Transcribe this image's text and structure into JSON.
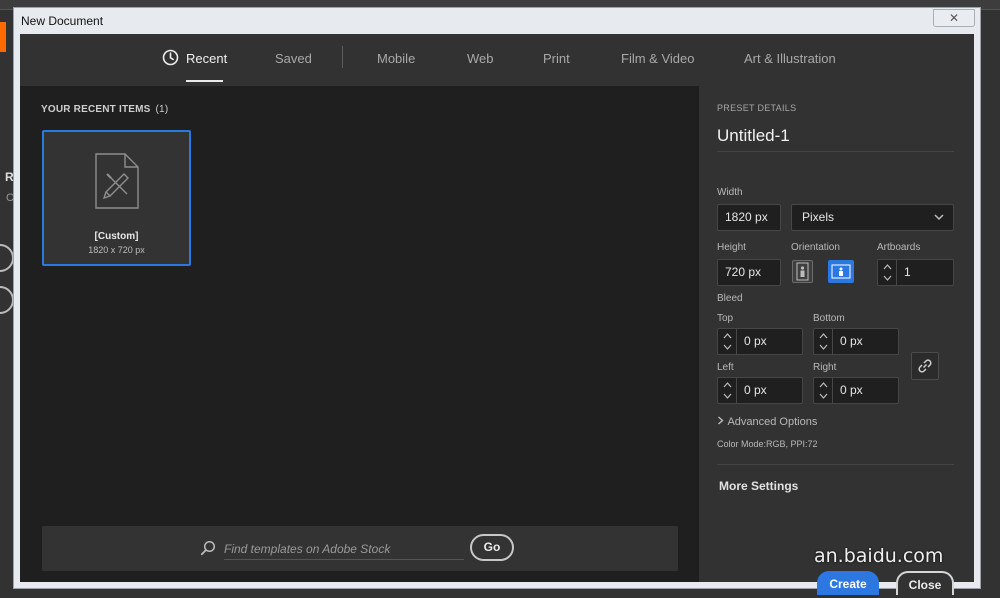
{
  "window": {
    "title": "New Document",
    "close_glyph": "✕"
  },
  "tabs": [
    {
      "label": "Recent",
      "active": true,
      "icon": "clock-icon"
    },
    {
      "label": "Saved"
    },
    {
      "label": "Mobile"
    },
    {
      "label": "Web"
    },
    {
      "label": "Print"
    },
    {
      "label": "Film & Video"
    },
    {
      "label": "Art & Illustration"
    }
  ],
  "recent": {
    "heading": "YOUR RECENT ITEMS",
    "count": "(1)",
    "items": [
      {
        "name": "[Custom]",
        "dims": "1820 x 720 px",
        "icon": "document-brush-icon"
      }
    ]
  },
  "search": {
    "placeholder": "Find templates on Adobe Stock",
    "go_label": "Go"
  },
  "preset": {
    "heading": "PRESET DETAILS",
    "name": "Untitled-1",
    "width_label": "Width",
    "width_value": "1820 px",
    "units": "Pixels",
    "height_label": "Height",
    "height_value": "720 px",
    "orientation_label": "Orientation",
    "artboards_label": "Artboards",
    "artboards_value": "1",
    "bleed_label": "Bleed",
    "top_label": "Top",
    "top_value": "0 px",
    "bottom_label": "Bottom",
    "bottom_value": "0 px",
    "left_label": "Left",
    "left_value": "0 px",
    "right_label": "Right",
    "right_value": "0 px",
    "advanced_label": "Advanced Options",
    "color_mode": "Color Mode:RGB, PPI:72",
    "more_settings": "More Settings"
  },
  "actions": {
    "create_label": "Create",
    "close_label": "Close"
  },
  "background": {
    "letter1": "R",
    "letter2": "C"
  },
  "watermark": "an.baidu.com",
  "colors": {
    "accent": "#2d78e0",
    "panel": "#323232",
    "canvas": "#1f1f1f"
  }
}
